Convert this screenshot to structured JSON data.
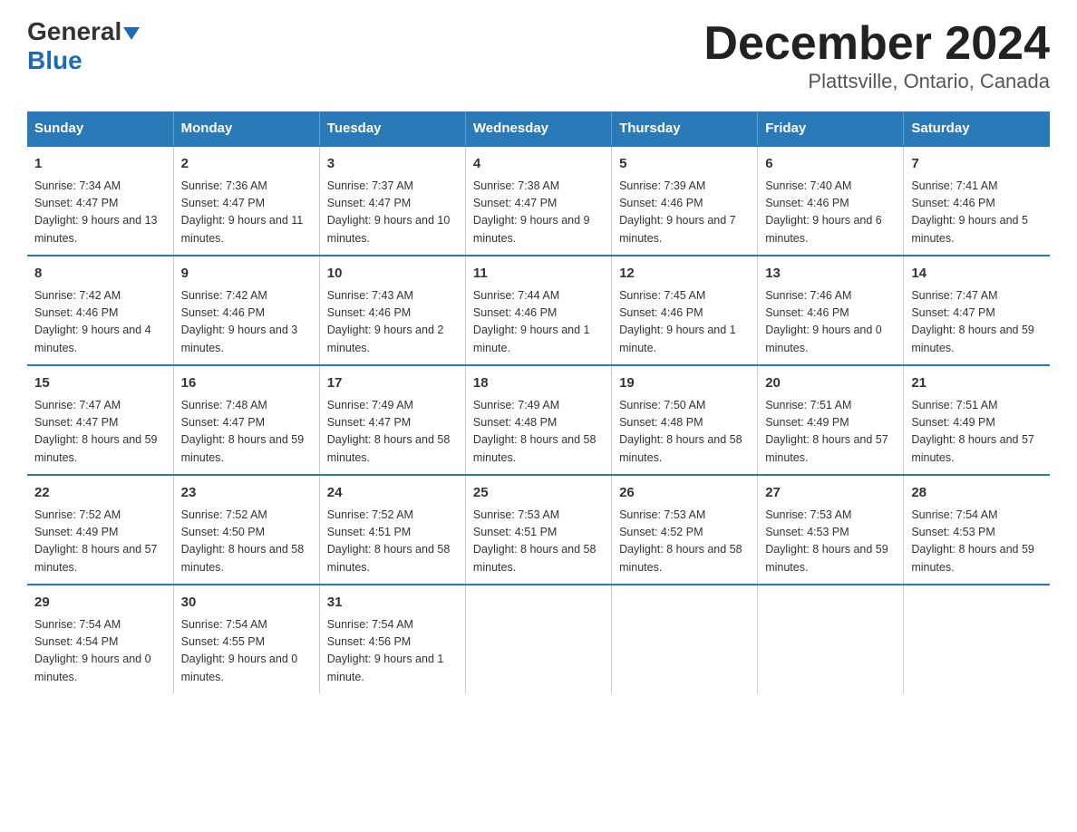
{
  "header": {
    "logo_line1": "General",
    "logo_line2": "Blue",
    "title": "December 2024",
    "subtitle": "Plattsville, Ontario, Canada"
  },
  "days_of_week": [
    "Sunday",
    "Monday",
    "Tuesday",
    "Wednesday",
    "Thursday",
    "Friday",
    "Saturday"
  ],
  "weeks": [
    [
      {
        "day": "1",
        "sunrise": "7:34 AM",
        "sunset": "4:47 PM",
        "daylight": "9 hours and 13 minutes."
      },
      {
        "day": "2",
        "sunrise": "7:36 AM",
        "sunset": "4:47 PM",
        "daylight": "9 hours and 11 minutes."
      },
      {
        "day": "3",
        "sunrise": "7:37 AM",
        "sunset": "4:47 PM",
        "daylight": "9 hours and 10 minutes."
      },
      {
        "day": "4",
        "sunrise": "7:38 AM",
        "sunset": "4:47 PM",
        "daylight": "9 hours and 9 minutes."
      },
      {
        "day": "5",
        "sunrise": "7:39 AM",
        "sunset": "4:46 PM",
        "daylight": "9 hours and 7 minutes."
      },
      {
        "day": "6",
        "sunrise": "7:40 AM",
        "sunset": "4:46 PM",
        "daylight": "9 hours and 6 minutes."
      },
      {
        "day": "7",
        "sunrise": "7:41 AM",
        "sunset": "4:46 PM",
        "daylight": "9 hours and 5 minutes."
      }
    ],
    [
      {
        "day": "8",
        "sunrise": "7:42 AM",
        "sunset": "4:46 PM",
        "daylight": "9 hours and 4 minutes."
      },
      {
        "day": "9",
        "sunrise": "7:42 AM",
        "sunset": "4:46 PM",
        "daylight": "9 hours and 3 minutes."
      },
      {
        "day": "10",
        "sunrise": "7:43 AM",
        "sunset": "4:46 PM",
        "daylight": "9 hours and 2 minutes."
      },
      {
        "day": "11",
        "sunrise": "7:44 AM",
        "sunset": "4:46 PM",
        "daylight": "9 hours and 1 minute."
      },
      {
        "day": "12",
        "sunrise": "7:45 AM",
        "sunset": "4:46 PM",
        "daylight": "9 hours and 1 minute."
      },
      {
        "day": "13",
        "sunrise": "7:46 AM",
        "sunset": "4:46 PM",
        "daylight": "9 hours and 0 minutes."
      },
      {
        "day": "14",
        "sunrise": "7:47 AM",
        "sunset": "4:47 PM",
        "daylight": "8 hours and 59 minutes."
      }
    ],
    [
      {
        "day": "15",
        "sunrise": "7:47 AM",
        "sunset": "4:47 PM",
        "daylight": "8 hours and 59 minutes."
      },
      {
        "day": "16",
        "sunrise": "7:48 AM",
        "sunset": "4:47 PM",
        "daylight": "8 hours and 59 minutes."
      },
      {
        "day": "17",
        "sunrise": "7:49 AM",
        "sunset": "4:47 PM",
        "daylight": "8 hours and 58 minutes."
      },
      {
        "day": "18",
        "sunrise": "7:49 AM",
        "sunset": "4:48 PM",
        "daylight": "8 hours and 58 minutes."
      },
      {
        "day": "19",
        "sunrise": "7:50 AM",
        "sunset": "4:48 PM",
        "daylight": "8 hours and 58 minutes."
      },
      {
        "day": "20",
        "sunrise": "7:51 AM",
        "sunset": "4:49 PM",
        "daylight": "8 hours and 57 minutes."
      },
      {
        "day": "21",
        "sunrise": "7:51 AM",
        "sunset": "4:49 PM",
        "daylight": "8 hours and 57 minutes."
      }
    ],
    [
      {
        "day": "22",
        "sunrise": "7:52 AM",
        "sunset": "4:49 PM",
        "daylight": "8 hours and 57 minutes."
      },
      {
        "day": "23",
        "sunrise": "7:52 AM",
        "sunset": "4:50 PM",
        "daylight": "8 hours and 58 minutes."
      },
      {
        "day": "24",
        "sunrise": "7:52 AM",
        "sunset": "4:51 PM",
        "daylight": "8 hours and 58 minutes."
      },
      {
        "day": "25",
        "sunrise": "7:53 AM",
        "sunset": "4:51 PM",
        "daylight": "8 hours and 58 minutes."
      },
      {
        "day": "26",
        "sunrise": "7:53 AM",
        "sunset": "4:52 PM",
        "daylight": "8 hours and 58 minutes."
      },
      {
        "day": "27",
        "sunrise": "7:53 AM",
        "sunset": "4:53 PM",
        "daylight": "8 hours and 59 minutes."
      },
      {
        "day": "28",
        "sunrise": "7:54 AM",
        "sunset": "4:53 PM",
        "daylight": "8 hours and 59 minutes."
      }
    ],
    [
      {
        "day": "29",
        "sunrise": "7:54 AM",
        "sunset": "4:54 PM",
        "daylight": "9 hours and 0 minutes."
      },
      {
        "day": "30",
        "sunrise": "7:54 AM",
        "sunset": "4:55 PM",
        "daylight": "9 hours and 0 minutes."
      },
      {
        "day": "31",
        "sunrise": "7:54 AM",
        "sunset": "4:56 PM",
        "daylight": "9 hours and 1 minute."
      },
      null,
      null,
      null,
      null
    ]
  ],
  "labels": {
    "sunrise": "Sunrise:",
    "sunset": "Sunset:",
    "daylight": "Daylight:"
  }
}
